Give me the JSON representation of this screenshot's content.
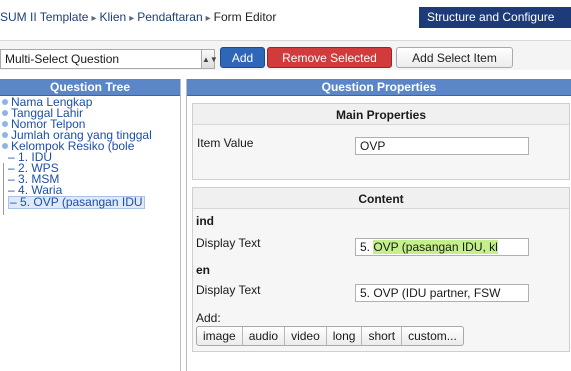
{
  "breadcrumb": {
    "items": [
      "SUM II Template",
      "Klien",
      "Pendaftaran"
    ],
    "current": "Form Editor"
  },
  "header": {
    "structure_tab": "Structure and Configure"
  },
  "toolbar": {
    "question_type_value": "Multi-Select Question",
    "add_label": "Add",
    "remove_label": "Remove Selected",
    "add_select_item_label": "Add Select Item"
  },
  "tree": {
    "title": "Question Tree",
    "items": [
      "Nama Lengkap",
      "Tanggal Lahir",
      "Nomor Telpon",
      "Jumlah orang yang tinggal",
      "Kelompok Resiko (bole"
    ],
    "children": [
      "1. IDU",
      "2. WPS",
      "3. MSM",
      "4. Waria",
      "5. OVP (pasangan IDU"
    ],
    "selected_child_index": 4
  },
  "properties": {
    "title": "Question Properties",
    "main": {
      "title": "Main Properties",
      "item_value_label": "Item Value",
      "item_value": "OVP"
    },
    "content": {
      "title": "Content",
      "lang1": "ind",
      "display_text_label": "Display Text",
      "display_text_ind_prefix": "5. ",
      "display_text_ind_highlight": "OVP (pasangan IDU, kl",
      "lang2": "en",
      "display_text_en": "5. OVP (IDU partner, FSW",
      "add_label": "Add:",
      "add_buttons": [
        "image",
        "audio",
        "video",
        "long",
        "short",
        "custom..."
      ]
    }
  },
  "colors": {
    "header_blue": "#1d3b78",
    "panel_header": "#5b86c7",
    "add_button": "#2f67b8",
    "remove_button": "#d13b3b",
    "highlight": "#c3f08a"
  }
}
